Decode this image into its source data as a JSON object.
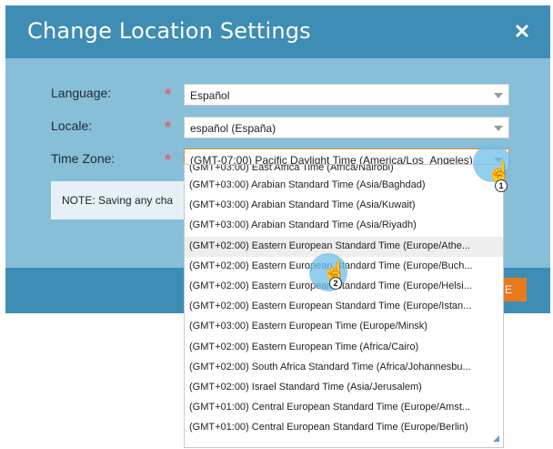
{
  "dialog": {
    "title": "Change Location Settings",
    "close_icon": "close-icon",
    "fields": {
      "language": {
        "label": "Language:",
        "value": "Español"
      },
      "locale": {
        "label": "Locale:",
        "value": "español (España)"
      },
      "timezone": {
        "label": "Time Zone:",
        "value": "(GMT-07:00) Pacific Daylight Time (America/Los_Angeles)"
      }
    },
    "required_mark": "*",
    "note": "NOTE: Saving any cha",
    "footer_button_label": "E"
  },
  "timezone_options": [
    "(GMT+03:00) East Africa Time (Africa/Nairobi)",
    "(GMT+03:00) Arabian Standard Time (Asia/Baghdad)",
    "(GMT+03:00) Arabian Standard Time (Asia/Kuwait)",
    "(GMT+03:00) Arabian Standard Time (Asia/Riyadh)",
    "(GMT+02:00) Eastern European Standard Time (Europe/Athe...",
    "(GMT+02:00) Eastern European Standard Time (Europe/Buch...",
    "(GMT+02:00) Eastern European Standard Time (Europe/Helsi...",
    "(GMT+02:00) Eastern European Standard Time (Europe/Istan...",
    "(GMT+03:00) Eastern European Time (Europe/Minsk)",
    "(GMT+02:00) Eastern European Time (Africa/Cairo)",
    "(GMT+02:00) South Africa Standard Time (Africa/Johannesbu...",
    "(GMT+02:00) Israel Standard Time (Asia/Jerusalem)",
    "(GMT+01:00) Central European Standard Time (Europe/Amst...",
    "(GMT+01:00) Central European Standard Time (Europe/Berlin)"
  ],
  "annotations": {
    "step1": "1",
    "step2": "2"
  },
  "colors": {
    "titlebar": "#3d8db5",
    "body": "#87bfd9",
    "accent": "#e87a1e",
    "required": "#d86a6a"
  }
}
